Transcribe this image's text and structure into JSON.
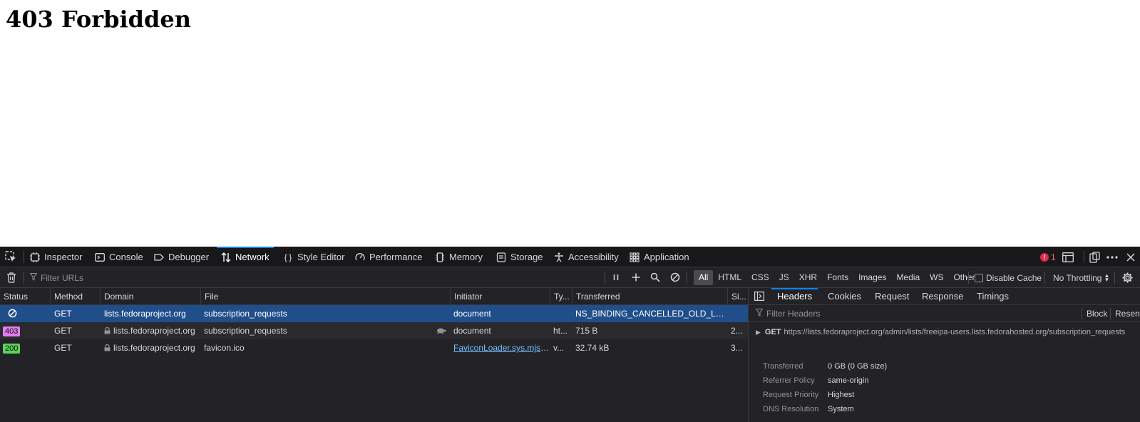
{
  "page": {
    "heading": "403 Forbidden"
  },
  "devtools": {
    "tabs": [
      {
        "label": "Inspector",
        "icon": "inspector-icon"
      },
      {
        "label": "Console",
        "icon": "console-icon"
      },
      {
        "label": "Debugger",
        "icon": "debugger-icon"
      },
      {
        "label": "Network",
        "icon": "network-icon",
        "active": true
      },
      {
        "label": "Style Editor",
        "icon": "style-editor-icon"
      },
      {
        "label": "Performance",
        "icon": "performance-icon"
      },
      {
        "label": "Memory",
        "icon": "memory-icon"
      },
      {
        "label": "Storage",
        "icon": "storage-icon"
      },
      {
        "label": "Accessibility",
        "icon": "accessibility-icon"
      },
      {
        "label": "Application",
        "icon": "application-icon"
      }
    ],
    "error_count": "1",
    "toolbar": {
      "filter_placeholder": "Filter URLs",
      "filter_types": [
        "All",
        "HTML",
        "CSS",
        "JS",
        "XHR",
        "Fonts",
        "Images",
        "Media",
        "WS",
        "Other"
      ],
      "active_filter": "All",
      "disable_cache": "Disable Cache",
      "throttling": "No Throttling"
    },
    "table": {
      "columns": [
        "Status",
        "Method",
        "Domain",
        "File",
        "Initiator",
        "Ty...",
        "Transferred",
        "Si..."
      ],
      "rows": [
        {
          "status": "",
          "status_icon": "blocked-icon",
          "method": "GET",
          "domain": "lists.fedoraproject.org",
          "secure": false,
          "file": "subscription_requests",
          "initiator": "document",
          "type": "",
          "transferred": "NS_BINDING_CANCELLED_OLD_LOAD",
          "size": "",
          "selected": true
        },
        {
          "status": "403",
          "status_color": "#e37ef0",
          "method": "GET",
          "domain": "lists.fedoraproject.org",
          "secure": true,
          "file": "subscription_requests",
          "throttled": true,
          "initiator": "document",
          "type": "ht...",
          "transferred": "715 B",
          "size": "2..."
        },
        {
          "status": "200",
          "status_color": "#5ad35a",
          "method": "GET",
          "domain": "lists.fedoraproject.org",
          "secure": true,
          "file": "favicon.ico",
          "initiator": "FaviconLoader.sys.mjs:...",
          "initiator_link": true,
          "type": "v...",
          "transferred": "32.74 kB",
          "size": "3..."
        }
      ]
    },
    "sidebar": {
      "tabs": [
        "Headers",
        "Cookies",
        "Request",
        "Response",
        "Timings"
      ],
      "active_tab": "Headers",
      "filter_placeholder": "Filter Headers",
      "block_label": "Block",
      "resend_label": "Resend",
      "request_method": "GET",
      "request_url": "https://lists.fedoraproject.org/admin/lists/freeipa-users.lists.fedorahosted.org/subscription_requests",
      "details": [
        {
          "key": "Transferred",
          "value": "0 GB (0 GB size)"
        },
        {
          "key": "Referrer Policy",
          "value": "same-origin"
        },
        {
          "key": "Request Priority",
          "value": "Highest"
        },
        {
          "key": "DNS Resolution",
          "value": "System"
        }
      ]
    }
  }
}
